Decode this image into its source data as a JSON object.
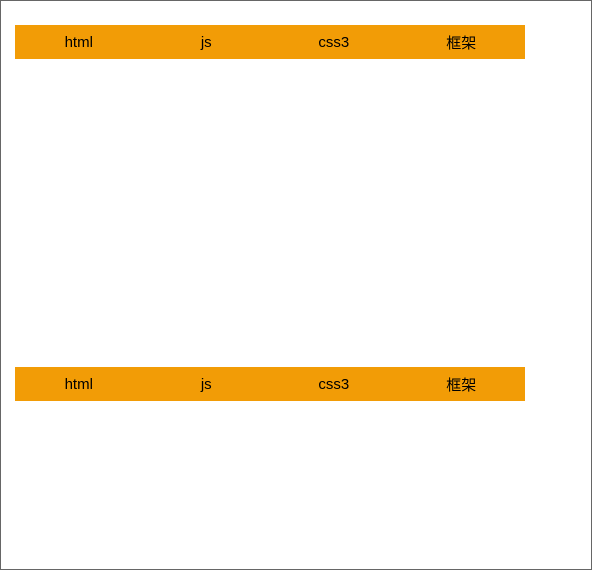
{
  "nav_top": {
    "items": [
      {
        "label": "html"
      },
      {
        "label": "js"
      },
      {
        "label": "css3"
      },
      {
        "label": "框架"
      }
    ]
  },
  "nav_bottom": {
    "items": [
      {
        "label": "html"
      },
      {
        "label": "js"
      },
      {
        "label": "css3"
      },
      {
        "label": "框架"
      }
    ]
  }
}
